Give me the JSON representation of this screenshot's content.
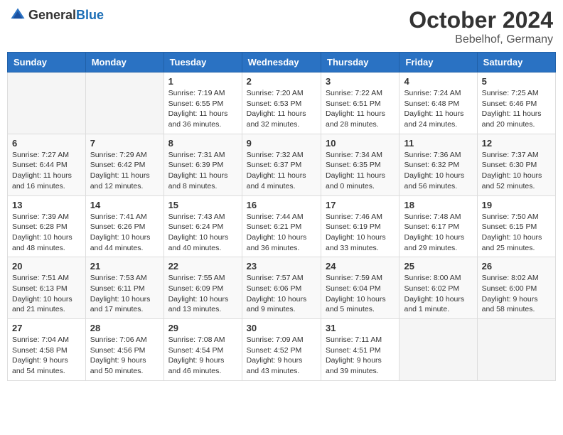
{
  "header": {
    "logo_general": "General",
    "logo_blue": "Blue",
    "month_title": "October 2024",
    "location": "Bebelhof, Germany"
  },
  "columns": [
    "Sunday",
    "Monday",
    "Tuesday",
    "Wednesday",
    "Thursday",
    "Friday",
    "Saturday"
  ],
  "weeks": [
    [
      {
        "day": "",
        "info": ""
      },
      {
        "day": "",
        "info": ""
      },
      {
        "day": "1",
        "info": "Sunrise: 7:19 AM\nSunset: 6:55 PM\nDaylight: 11 hours and 36 minutes."
      },
      {
        "day": "2",
        "info": "Sunrise: 7:20 AM\nSunset: 6:53 PM\nDaylight: 11 hours and 32 minutes."
      },
      {
        "day": "3",
        "info": "Sunrise: 7:22 AM\nSunset: 6:51 PM\nDaylight: 11 hours and 28 minutes."
      },
      {
        "day": "4",
        "info": "Sunrise: 7:24 AM\nSunset: 6:48 PM\nDaylight: 11 hours and 24 minutes."
      },
      {
        "day": "5",
        "info": "Sunrise: 7:25 AM\nSunset: 6:46 PM\nDaylight: 11 hours and 20 minutes."
      }
    ],
    [
      {
        "day": "6",
        "info": "Sunrise: 7:27 AM\nSunset: 6:44 PM\nDaylight: 11 hours and 16 minutes."
      },
      {
        "day": "7",
        "info": "Sunrise: 7:29 AM\nSunset: 6:42 PM\nDaylight: 11 hours and 12 minutes."
      },
      {
        "day": "8",
        "info": "Sunrise: 7:31 AM\nSunset: 6:39 PM\nDaylight: 11 hours and 8 minutes."
      },
      {
        "day": "9",
        "info": "Sunrise: 7:32 AM\nSunset: 6:37 PM\nDaylight: 11 hours and 4 minutes."
      },
      {
        "day": "10",
        "info": "Sunrise: 7:34 AM\nSunset: 6:35 PM\nDaylight: 11 hours and 0 minutes."
      },
      {
        "day": "11",
        "info": "Sunrise: 7:36 AM\nSunset: 6:32 PM\nDaylight: 10 hours and 56 minutes."
      },
      {
        "day": "12",
        "info": "Sunrise: 7:37 AM\nSunset: 6:30 PM\nDaylight: 10 hours and 52 minutes."
      }
    ],
    [
      {
        "day": "13",
        "info": "Sunrise: 7:39 AM\nSunset: 6:28 PM\nDaylight: 10 hours and 48 minutes."
      },
      {
        "day": "14",
        "info": "Sunrise: 7:41 AM\nSunset: 6:26 PM\nDaylight: 10 hours and 44 minutes."
      },
      {
        "day": "15",
        "info": "Sunrise: 7:43 AM\nSunset: 6:24 PM\nDaylight: 10 hours and 40 minutes."
      },
      {
        "day": "16",
        "info": "Sunrise: 7:44 AM\nSunset: 6:21 PM\nDaylight: 10 hours and 36 minutes."
      },
      {
        "day": "17",
        "info": "Sunrise: 7:46 AM\nSunset: 6:19 PM\nDaylight: 10 hours and 33 minutes."
      },
      {
        "day": "18",
        "info": "Sunrise: 7:48 AM\nSunset: 6:17 PM\nDaylight: 10 hours and 29 minutes."
      },
      {
        "day": "19",
        "info": "Sunrise: 7:50 AM\nSunset: 6:15 PM\nDaylight: 10 hours and 25 minutes."
      }
    ],
    [
      {
        "day": "20",
        "info": "Sunrise: 7:51 AM\nSunset: 6:13 PM\nDaylight: 10 hours and 21 minutes."
      },
      {
        "day": "21",
        "info": "Sunrise: 7:53 AM\nSunset: 6:11 PM\nDaylight: 10 hours and 17 minutes."
      },
      {
        "day": "22",
        "info": "Sunrise: 7:55 AM\nSunset: 6:09 PM\nDaylight: 10 hours and 13 minutes."
      },
      {
        "day": "23",
        "info": "Sunrise: 7:57 AM\nSunset: 6:06 PM\nDaylight: 10 hours and 9 minutes."
      },
      {
        "day": "24",
        "info": "Sunrise: 7:59 AM\nSunset: 6:04 PM\nDaylight: 10 hours and 5 minutes."
      },
      {
        "day": "25",
        "info": "Sunrise: 8:00 AM\nSunset: 6:02 PM\nDaylight: 10 hours and 1 minute."
      },
      {
        "day": "26",
        "info": "Sunrise: 8:02 AM\nSunset: 6:00 PM\nDaylight: 9 hours and 58 minutes."
      }
    ],
    [
      {
        "day": "27",
        "info": "Sunrise: 7:04 AM\nSunset: 4:58 PM\nDaylight: 9 hours and 54 minutes."
      },
      {
        "day": "28",
        "info": "Sunrise: 7:06 AM\nSunset: 4:56 PM\nDaylight: 9 hours and 50 minutes."
      },
      {
        "day": "29",
        "info": "Sunrise: 7:08 AM\nSunset: 4:54 PM\nDaylight: 9 hours and 46 minutes."
      },
      {
        "day": "30",
        "info": "Sunrise: 7:09 AM\nSunset: 4:52 PM\nDaylight: 9 hours and 43 minutes."
      },
      {
        "day": "31",
        "info": "Sunrise: 7:11 AM\nSunset: 4:51 PM\nDaylight: 9 hours and 39 minutes."
      },
      {
        "day": "",
        "info": ""
      },
      {
        "day": "",
        "info": ""
      }
    ]
  ]
}
